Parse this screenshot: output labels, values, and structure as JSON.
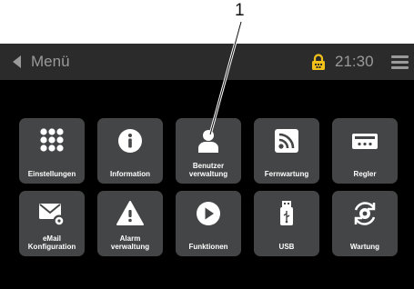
{
  "callout": {
    "number": "1"
  },
  "titlebar": {
    "title": "Menü",
    "time": "21:30"
  },
  "tiles": [
    {
      "label": "Einstellungen",
      "icon": "keypad-icon"
    },
    {
      "label": "Information",
      "icon": "info-icon"
    },
    {
      "label": "Benutzer\nverwaltung",
      "icon": "user-icon"
    },
    {
      "label": "Fernwartung",
      "icon": "remote-signal-icon"
    },
    {
      "label": "Regler",
      "icon": "controller-display-icon"
    },
    {
      "label": "eMail\nKonfiguration",
      "icon": "email-settings-icon"
    },
    {
      "label": "Alarm\nverwaltung",
      "icon": "alarm-warning-icon"
    },
    {
      "label": "Funktionen",
      "icon": "play-icon"
    },
    {
      "label": "USB",
      "icon": "usb-stick-icon"
    },
    {
      "label": "Wartung",
      "icon": "maintenance-icon"
    }
  ],
  "colors": {
    "accent": "#f2c21b",
    "tile": "#444546",
    "titlebar": "#2b2b2b",
    "screen": "#000000"
  }
}
